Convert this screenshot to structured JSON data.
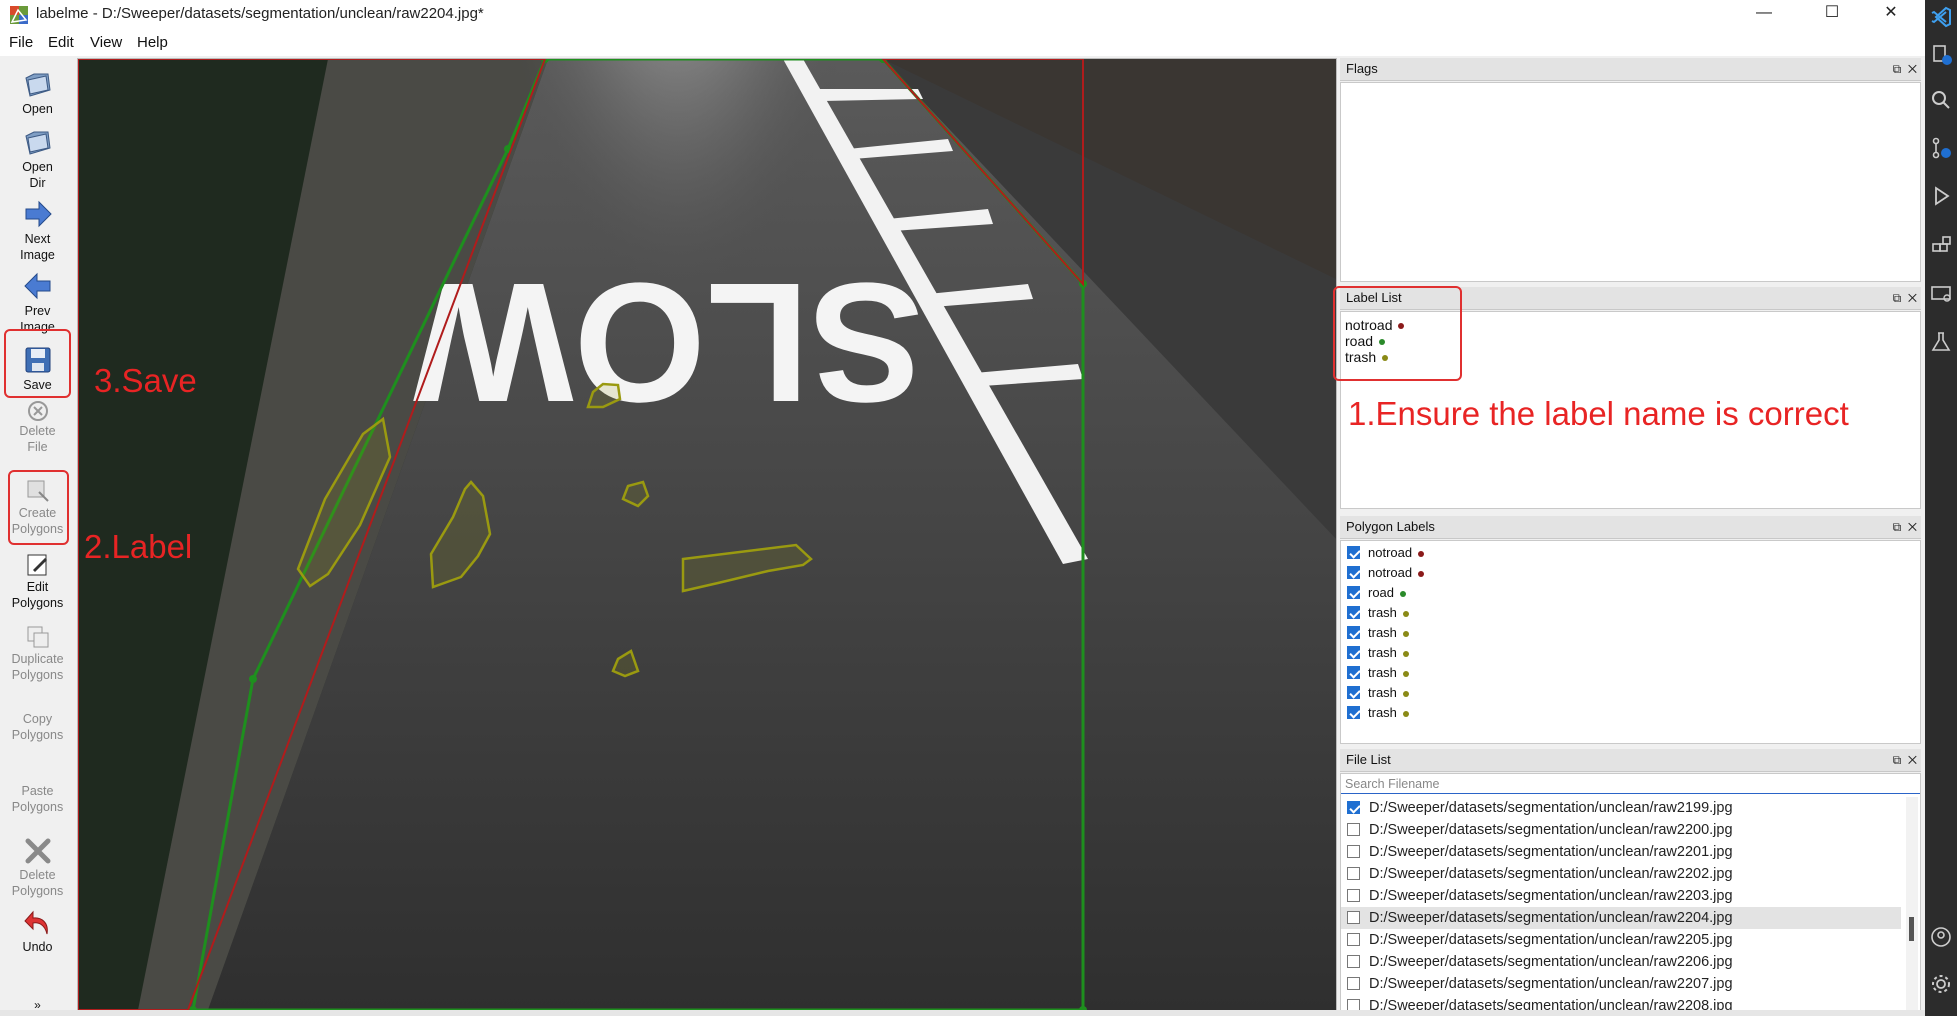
{
  "window": {
    "title": "labelme - D:/Sweeper/datasets/segmentation/unclean/raw2204.jpg*",
    "minimize": "—",
    "maximize": "☐",
    "close": "✕"
  },
  "menu": {
    "file": "File",
    "edit": "Edit",
    "view": "View",
    "help": "Help"
  },
  "toolbar": {
    "open": "Open",
    "open_dir": [
      "Open",
      "Dir"
    ],
    "next_image": [
      "Next",
      "Image"
    ],
    "prev_image": [
      "Prev",
      "Image"
    ],
    "save": "Save",
    "delete_file": [
      "Delete",
      "File"
    ],
    "create_polygons": [
      "Create",
      "Polygons"
    ],
    "edit_polygons": [
      "Edit",
      "Polygons"
    ],
    "duplicate_polygons": [
      "Duplicate",
      "Polygons"
    ],
    "copy_polygons": [
      "Copy",
      "Polygons"
    ],
    "paste_polygons": [
      "Paste",
      "Polygons"
    ],
    "delete_polygons": [
      "Delete",
      "Polygons"
    ],
    "undo": "Undo",
    "more": "»"
  },
  "canvas": {
    "road_marking": "SLOW",
    "colors": {
      "road": "#1e8f1e",
      "notroad": "#b01c1c",
      "trash": "#9a9a10"
    }
  },
  "annotations": {
    "step1": "1.Ensure the label name is correct",
    "step2": "2.Label",
    "step3": "3.Save",
    "color": "#e82424"
  },
  "flags_panel": {
    "title": "Flags"
  },
  "label_list": {
    "title": "Label List",
    "items": [
      {
        "label": "notroad",
        "color": "#8b1a1a"
      },
      {
        "label": "road",
        "color": "#2a8a2a"
      },
      {
        "label": "trash",
        "color": "#8a8a16"
      }
    ]
  },
  "polygon_labels": {
    "title": "Polygon Labels",
    "items": [
      {
        "label": "notroad",
        "checked": true,
        "color": "#8b1a1a"
      },
      {
        "label": "notroad",
        "checked": true,
        "color": "#8b1a1a"
      },
      {
        "label": "road",
        "checked": true,
        "color": "#2a8a2a"
      },
      {
        "label": "trash",
        "checked": true,
        "color": "#8a8a16"
      },
      {
        "label": "trash",
        "checked": true,
        "color": "#8a8a16"
      },
      {
        "label": "trash",
        "checked": true,
        "color": "#8a8a16"
      },
      {
        "label": "trash",
        "checked": true,
        "color": "#8a8a16"
      },
      {
        "label": "trash",
        "checked": true,
        "color": "#8a8a16"
      },
      {
        "label": "trash",
        "checked": true,
        "color": "#8a8a16"
      }
    ]
  },
  "file_list": {
    "title": "File List",
    "search_placeholder": "Search Filename",
    "files": [
      {
        "path": "D:/Sweeper/datasets/segmentation/unclean/raw2199.jpg",
        "checked": true,
        "selected": false
      },
      {
        "path": "D:/Sweeper/datasets/segmentation/unclean/raw2200.jpg",
        "checked": false,
        "selected": false
      },
      {
        "path": "D:/Sweeper/datasets/segmentation/unclean/raw2201.jpg",
        "checked": false,
        "selected": false
      },
      {
        "path": "D:/Sweeper/datasets/segmentation/unclean/raw2202.jpg",
        "checked": false,
        "selected": false
      },
      {
        "path": "D:/Sweeper/datasets/segmentation/unclean/raw2203.jpg",
        "checked": false,
        "selected": false
      },
      {
        "path": "D:/Sweeper/datasets/segmentation/unclean/raw2204.jpg",
        "checked": false,
        "selected": true
      },
      {
        "path": "D:/Sweeper/datasets/segmentation/unclean/raw2205.jpg",
        "checked": false,
        "selected": false
      },
      {
        "path": "D:/Sweeper/datasets/segmentation/unclean/raw2206.jpg",
        "checked": false,
        "selected": false
      },
      {
        "path": "D:/Sweeper/datasets/segmentation/unclean/raw2207.jpg",
        "checked": false,
        "selected": false
      },
      {
        "path": "D:/Sweeper/datasets/segmentation/unclean/raw2208.jpg",
        "checked": false,
        "selected": false
      }
    ]
  },
  "panel_buttons": {
    "float": "⧉",
    "close": "✕"
  }
}
